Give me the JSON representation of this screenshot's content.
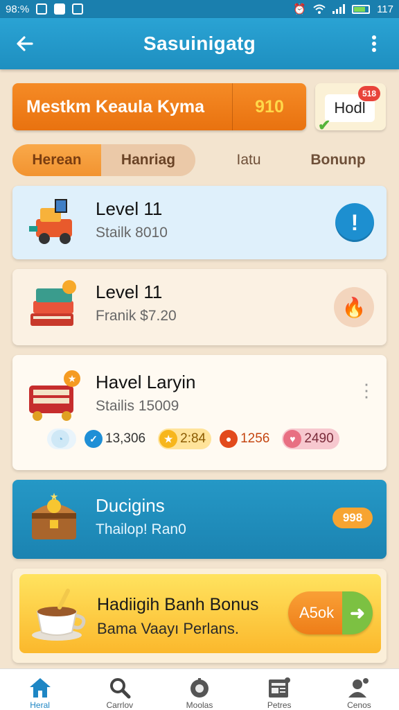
{
  "status_bar": {
    "battery_text": "98:%",
    "time": "117"
  },
  "app_bar": {
    "title": "Sasuinigatg"
  },
  "banner": {
    "name": "Mestkm Keaula Kyma",
    "value": "910"
  },
  "hodl": {
    "label": "Hodl",
    "badge": "518"
  },
  "tabs": [
    {
      "label": "Herean"
    },
    {
      "label": "Hanriag"
    },
    {
      "label": "Iatu"
    },
    {
      "label": "Bonunp"
    }
  ],
  "cards": [
    {
      "title": "Level 11",
      "subtitle": "Stailk 8010",
      "action_icon": "info-icon"
    },
    {
      "title": "Level 11",
      "subtitle": "Franik $7.20",
      "action_icon": "flame-icon"
    },
    {
      "title": "Havel Laryin",
      "subtitle": "Stailis 15009",
      "stats": [
        {
          "value": ""
        },
        {
          "value": "13,306"
        },
        {
          "value": "2:84"
        },
        {
          "value": "1256"
        },
        {
          "value": "2490"
        }
      ]
    },
    {
      "title": "Ducigins",
      "subtitle": "Thailop! Ran0",
      "badge": "998"
    }
  ],
  "bonus": {
    "title": "Hadiigih Banh Bonus",
    "subtitle": "Bama Vaayı Perlans.",
    "button": "A5ok"
  },
  "nav": [
    {
      "label": "Heral",
      "icon": "home-icon"
    },
    {
      "label": "Carrlov",
      "icon": "search-icon"
    },
    {
      "label": "Moolas",
      "icon": "piggy-bank-icon"
    },
    {
      "label": "Petres",
      "icon": "news-icon"
    },
    {
      "label": "Cenos",
      "icon": "profile-icon"
    }
  ],
  "colors": {
    "primary": "#1e8fc0",
    "accent": "#f58b26",
    "background": "#f3e4cf"
  }
}
